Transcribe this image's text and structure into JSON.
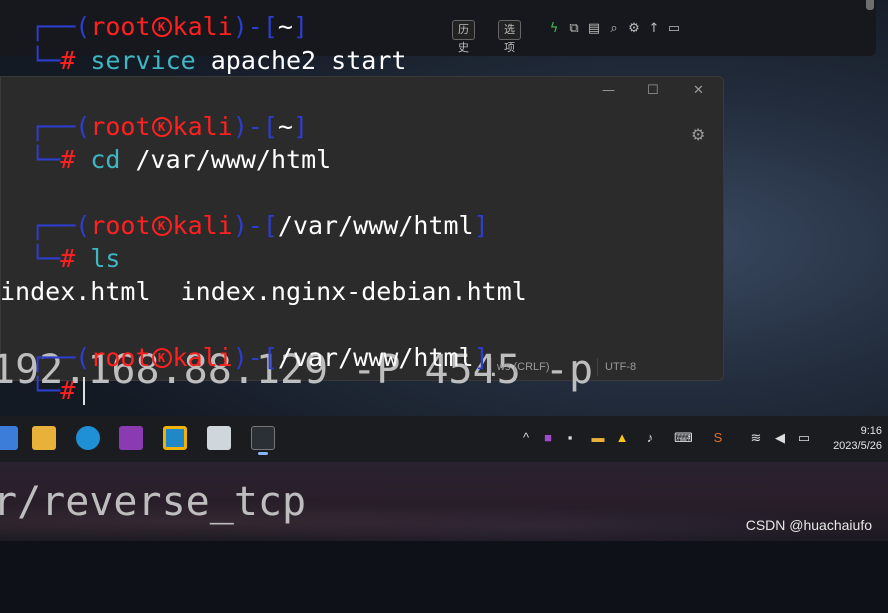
{
  "terminal": {
    "user": "root",
    "host": "kali",
    "blocks": [
      {
        "path": "~",
        "command_head": "service",
        "command_rest": " apache2 start"
      },
      {
        "path": "~",
        "command_head": "cd",
        "command_rest": " /var/www/html"
      },
      {
        "path": "/var/www/html",
        "command_head": "ls",
        "command_rest": ""
      },
      {
        "path": "/var/www/html",
        "command_head": "",
        "command_rest": ""
      }
    ],
    "output_ls": "index.html  index.nginx-debian.html",
    "prompt_symbol": "#",
    "toolbar": {
      "history_label": "历史",
      "options_label": "选项"
    }
  },
  "notepad": {
    "bg_text_line1": "192.168.88.129 -P 4545 -p",
    "bg_text_line2": "r/reverse_tcp",
    "status_eol": "ws (CRLF)",
    "status_encoding": "UTF-8"
  },
  "taskbar": {
    "time": "9:16",
    "date": "2023/5/26"
  },
  "watermark": "CSDN @huachaiufo",
  "colors": {
    "prompt_blue": "#2d3dcc",
    "prompt_red": "#ff2020",
    "command_cyan": "#3fb7c3"
  }
}
